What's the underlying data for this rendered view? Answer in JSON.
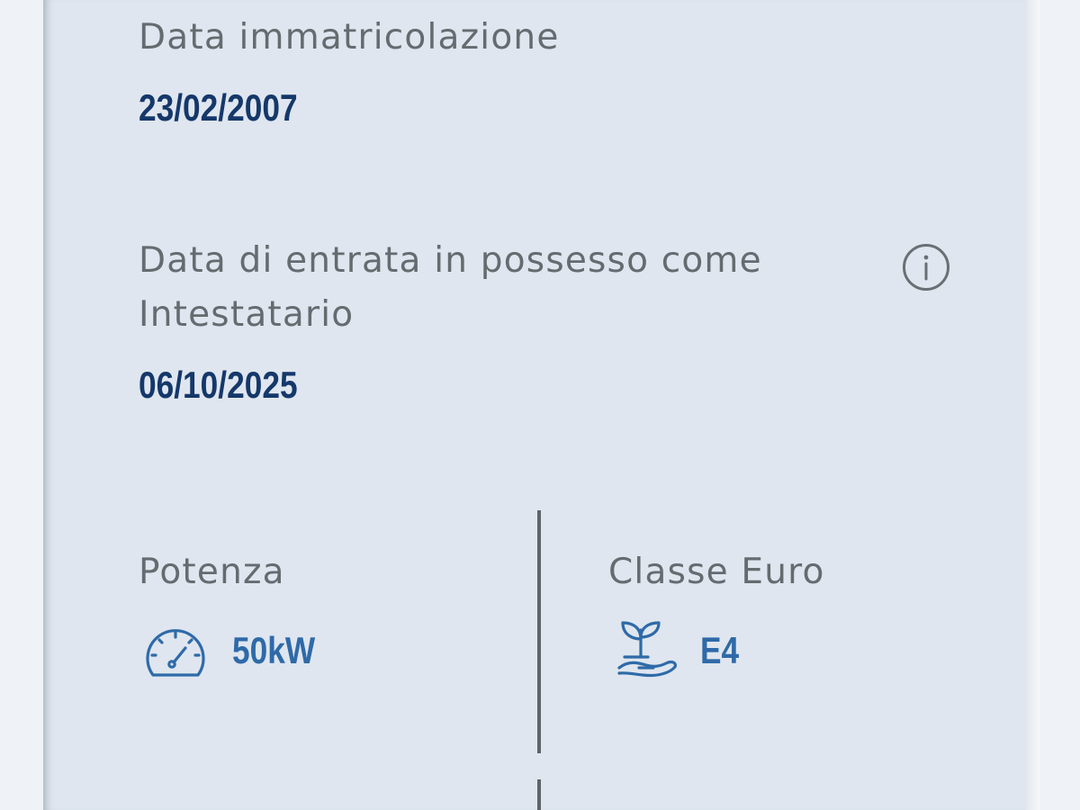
{
  "vehicle_details": {
    "registration_date": {
      "label": "Data immatricolazione",
      "value": "23/02/2007"
    },
    "ownership_date": {
      "label_line1": "Data di entrata in possesso come",
      "label_line2": "Intestatario",
      "value": "06/10/2025",
      "info_icon": "info-circle-icon"
    },
    "power": {
      "label": "Potenza",
      "value": "50kW",
      "icon": "speedometer-icon"
    },
    "euro_class": {
      "label": "Classe Euro",
      "value": "E4",
      "icon": "plant-in-hand-icon"
    }
  },
  "colors": {
    "card_background": "#dfe6ef",
    "label_text": "#666b70",
    "value_text": "#15386a",
    "accent": "#2f6aa8",
    "divider": "#5f6468"
  }
}
